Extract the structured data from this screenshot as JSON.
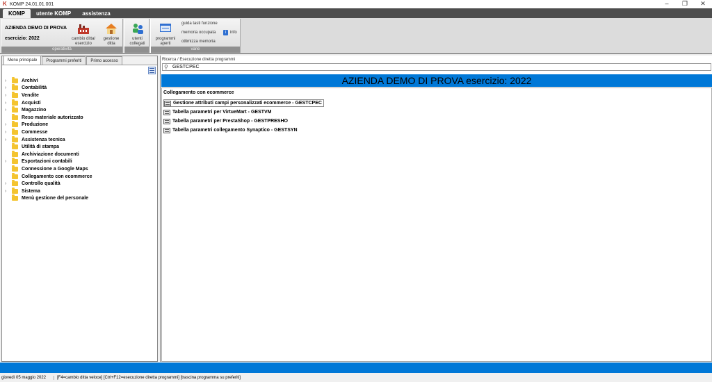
{
  "window": {
    "title": "KOMP 24.01.01.001",
    "controls": [
      "–",
      "❐",
      "✕"
    ]
  },
  "menu": {
    "tabs": [
      "KOMP",
      "utente KOMP",
      "assistenza"
    ]
  },
  "ribbon": {
    "company": "AZIENDA DEMO DI PROVA",
    "esercizio": "esercizio: 2022",
    "group_operativita": "operatività",
    "group_varie": "varie",
    "btn_cambio_line1": "cambio ditta/",
    "btn_cambio_line2": "esercizio",
    "btn_gestione_line1": "gestione",
    "btn_gestione_line2": "ditta",
    "btn_utenti_line1": "utenti",
    "btn_utenti_line2": "collegati",
    "btn_programmi_line1": "programmi",
    "btn_programmi_line2": "aperti",
    "link_guida": "guida tasti funzione",
    "link_memoria": "memoria occupata",
    "link_info": "info",
    "link_ottimizza": "ottimizza memoria"
  },
  "left": {
    "tabs": [
      "Menu principale",
      "Programmi preferiti",
      "Primo accesso"
    ],
    "tree": [
      {
        "label": "Archivi",
        "expandable": true
      },
      {
        "label": "Contabilità",
        "expandable": true
      },
      {
        "label": "Vendite",
        "expandable": true
      },
      {
        "label": "Acquisti",
        "expandable": true
      },
      {
        "label": "Magazzino",
        "expandable": true
      },
      {
        "label": "Reso materiale autorizzato",
        "expandable": false
      },
      {
        "label": "Produzione",
        "expandable": true
      },
      {
        "label": "Commesse",
        "expandable": true
      },
      {
        "label": "Assistenza tecnica",
        "expandable": true
      },
      {
        "label": "Utilità di stampa",
        "expandable": false
      },
      {
        "label": "Archiviazione documenti",
        "expandable": false
      },
      {
        "label": "Esportazioni contabili",
        "expandable": true
      },
      {
        "label": "Connessione a Google Maps",
        "expandable": false
      },
      {
        "label": "Collegamento con ecommerce",
        "expandable": false
      },
      {
        "label": "Controllo qualità",
        "expandable": true
      },
      {
        "label": "Sistema",
        "expandable": true
      },
      {
        "label": "Menù gestione del personale",
        "expandable": false
      }
    ]
  },
  "right": {
    "search_label": "Ricerca / Esecuzione diretta programmi",
    "search_value": "GESTCPEC",
    "banner": "AZIENDA DEMO DI PROVA  esercizio: 2022",
    "section_title": "Collegamento con ecommerce",
    "programs": [
      "Gestione attributi campi personalizzati ecommerce - GESTCPEC",
      "Tabella parametri per VirtueMart - GESTVM",
      "Tabella parametri per PrestaShop - GESTPRESHO",
      "Tabella parametri collegamento Synaptico - GESTSYN"
    ]
  },
  "status": {
    "date": "giovedì 05 maggio 2022",
    "hints": "[F4=cambio ditta veloce] [Ctrl+F12=esecuzione diretta programmi] [trascina programma su preferiti]"
  },
  "colors": {
    "accent_blue": "#0078d7",
    "menubar": "#4d4d4d",
    "folder": "#f4c430"
  }
}
